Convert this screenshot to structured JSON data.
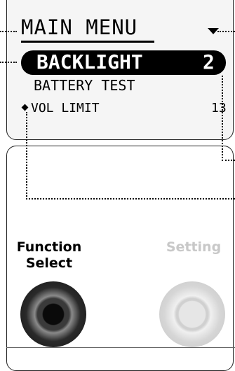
{
  "screen": {
    "menu_title": "MAIN MENU",
    "items": [
      {
        "label": "BACKLIGHT",
        "value": "2",
        "selected": true
      },
      {
        "label": "BATTERY TEST",
        "value": ""
      },
      {
        "label": "VOL LIMIT",
        "value": "13",
        "marker": "diamond-icon"
      }
    ],
    "scroll_indicator": "arrow-down-icon"
  },
  "controls": {
    "function_select_label": "Function Select",
    "setting_label": "Setting",
    "function_select_active": true,
    "setting_active": false
  },
  "colors": {
    "screen_background": "#f5f5f5",
    "selected_row": "#000000",
    "inactive_label": "#c8c8c8"
  }
}
